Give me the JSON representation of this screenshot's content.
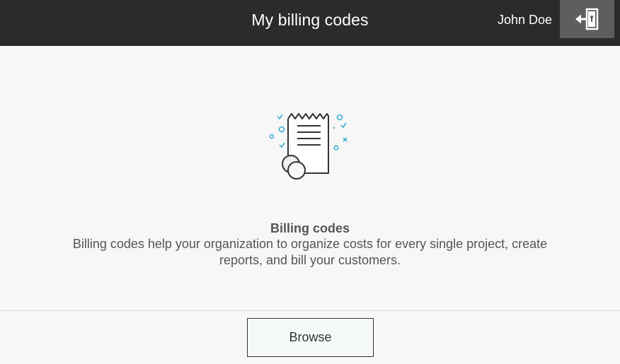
{
  "header": {
    "title": "My billing codes",
    "user_name": "John Doe",
    "logout_icon": "logout-door-icon"
  },
  "empty_state": {
    "icon": "receipt-coins-icon",
    "title": "Billing codes",
    "description": "Billing codes help your organization to organize costs for every single project, create reports, and bill your customers."
  },
  "footer": {
    "browse_label": "Browse"
  },
  "colors": {
    "header_bg": "#2b2b2b",
    "logout_bg": "#5e5e5e",
    "page_bg": "#f7f7f7",
    "accent": "#3ab0d0"
  }
}
